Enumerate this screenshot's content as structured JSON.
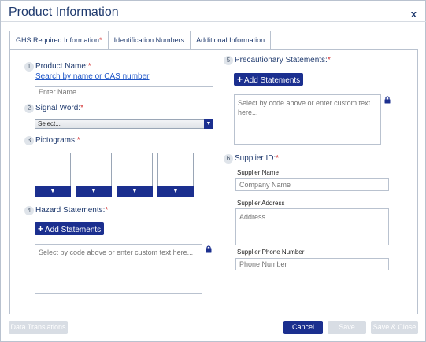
{
  "dialog": {
    "title": "Product Information",
    "close_label": "x"
  },
  "tabs": [
    {
      "label": "GHS Required Information",
      "required": "*",
      "active": true
    },
    {
      "label": "Identification Numbers",
      "active": false
    },
    {
      "label": "Additional Information",
      "active": false
    }
  ],
  "required_mark": "*",
  "fields": {
    "product_name": {
      "number": "1",
      "label": "Product Name:",
      "link": "Search by name or CAS number",
      "placeholder": "Enter Name"
    },
    "signal_word": {
      "number": "2",
      "label": "Signal Word:",
      "selected": "Select..."
    },
    "pictograms": {
      "number": "3",
      "label": "Pictograms:",
      "count": 4
    },
    "hazard_statements": {
      "number": "4",
      "label": "Hazard Statements:",
      "button": "Add Statements",
      "placeholder": "Select by code above or enter custom text here..."
    },
    "precautionary_statements": {
      "number": "5",
      "label": "Precautionary Statements:",
      "button": "Add Statements",
      "placeholder": "Select by code above or enter custom text here..."
    },
    "supplier": {
      "number": "6",
      "label": "Supplier ID:",
      "name_label": "Supplier Name",
      "name_placeholder": "Company Name",
      "address_label": "Supplier Address",
      "address_placeholder": "Address",
      "phone_label": "Supplier Phone Number",
      "phone_placeholder": "Phone Number"
    }
  },
  "footer": {
    "data_translations": "Data Translations",
    "cancel": "Cancel",
    "save": "Save",
    "save_close": "Save & Close"
  },
  "colors": {
    "primary": "#1b2f8f",
    "title_text": "#1f3a6e",
    "required": "#d12a2a",
    "link": "#1f56c7",
    "disabled": "#d8dde4"
  },
  "icons": {
    "plus": "plus-icon",
    "lock": "lock-icon",
    "dropdown": "chevron-down-icon"
  }
}
